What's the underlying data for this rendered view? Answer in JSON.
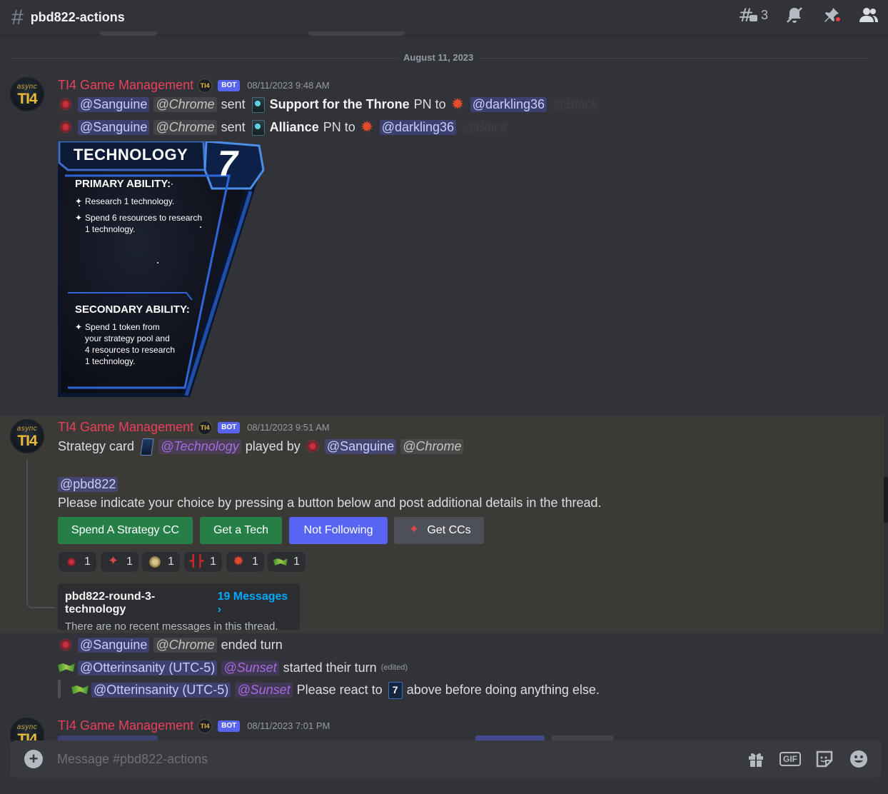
{
  "channel": {
    "name": "pbd822-actions",
    "threads_count": "3"
  },
  "date_divider": "August 11, 2023",
  "messages": [
    {
      "author": "TI4 Game Management",
      "bot_tag": "BOT",
      "time": "08/11/2023 9:48 AM",
      "lines": [
        {
          "mention1": "@Sanguine",
          "role1": "@Chrome",
          "verb": "sent",
          "item": "Support for the Throne",
          "suffix": "PN to",
          "mention2": "@darkling36",
          "role2": "@Black"
        },
        {
          "mention1": "@Sanguine",
          "role1": "@Chrome",
          "verb": "sent",
          "item": "Alliance",
          "suffix": "PN to",
          "mention2": "@darkling36",
          "role2": "@Black"
        }
      ],
      "card": {
        "title": "TECHNOLOGY",
        "number": "7",
        "primary_heading": "PRIMARY ABILITY:",
        "primary_1": "Research 1 technology.",
        "primary_2a": "Spend 6 resources to research",
        "primary_2b": "1 technology.",
        "secondary_heading": "SECONDARY ABILITY:",
        "secondary_a": "Spend 1 token from",
        "secondary_b": "your strategy pool and",
        "secondary_c": "4 resources to research",
        "secondary_d": "1 technology."
      }
    },
    {
      "author": "TI4 Game Management",
      "bot_tag": "BOT",
      "time": "08/11/2023 9:51 AM",
      "strategy_prefix": "Strategy card",
      "strategy_role": "@Technology",
      "played_by": "played by",
      "mention1": "@Sanguine",
      "role1": "@Chrome",
      "ping": "@pbd822",
      "instruction": "Please indicate your choice by pressing a button below and post additional details in the thread.",
      "buttons": [
        "Spend A Strategy CC",
        "Get a Tech",
        "Not Following",
        "Get CCs"
      ],
      "reactions": [
        "1",
        "1",
        "1",
        "1",
        "1",
        "1"
      ],
      "thread": {
        "name": "pbd822-round-3-technology",
        "count": "19 Messages ›",
        "empty_text": "There are no recent messages in this thread."
      }
    },
    {
      "ended": {
        "mention": "@Sanguine",
        "role": "@Chrome",
        "text": "ended turn"
      },
      "started": {
        "mention": "@Otterinsanity (UTC-5)",
        "role": "@Sunset",
        "text": "started their turn",
        "edited": "(edited)"
      },
      "react": {
        "mention": "@Otterinsanity (UTC-5)",
        "role": "@Sunset",
        "text_before": "Please react to",
        "text_after": "above before doing anything else."
      }
    },
    {
      "author": "TI4 Game Management",
      "bot_tag": "BOT",
      "time": "08/11/2023 7:01 PM"
    }
  ],
  "composer": {
    "placeholder": "Message #pbd822-actions",
    "gif": "GIF"
  },
  "avatar": {
    "top": "async",
    "bottom": "TI4"
  },
  "icons": [
    "threads-icon",
    "mute-icon",
    "pin-icon",
    "members-icon",
    "gift-icon",
    "gif-icon",
    "sticker-icon",
    "emoji-icon"
  ]
}
